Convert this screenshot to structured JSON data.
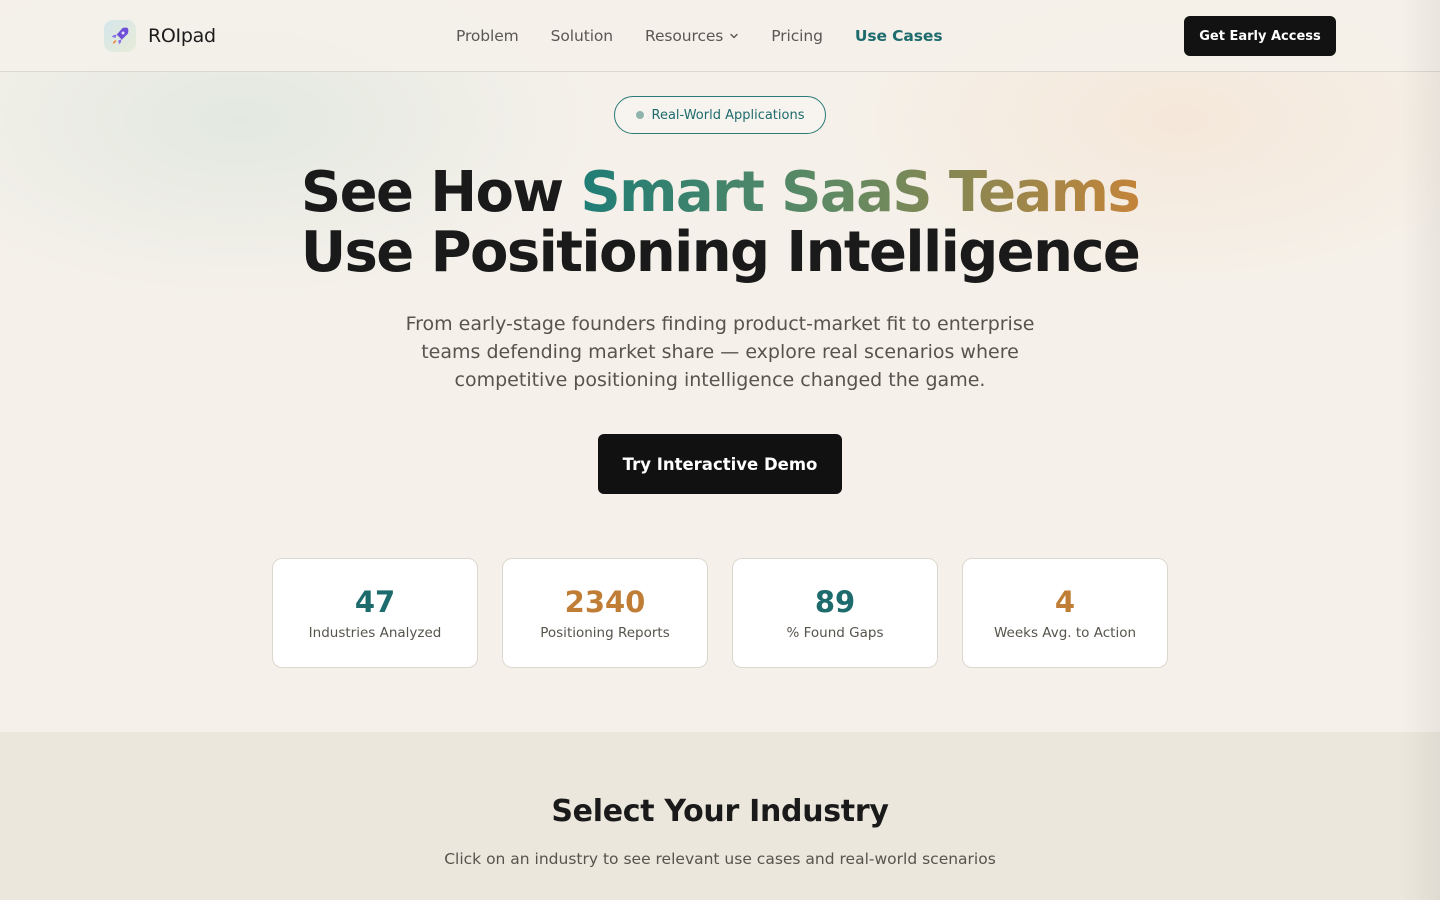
{
  "header": {
    "brand": "ROIpad",
    "logo_icon": "rocket-icon",
    "nav": [
      {
        "label": "Problem"
      },
      {
        "label": "Solution"
      },
      {
        "label": "Resources"
      },
      {
        "label": "Pricing"
      },
      {
        "label": "Use Cases"
      }
    ],
    "cta_label": "Get Early Access"
  },
  "hero": {
    "badge": "Real-World Applications",
    "title_part1": "See How ",
    "title_highlight": "Smart SaaS Teams",
    "title_line2": "Use Positioning Intelligence",
    "subtitle": "From early-stage founders finding product-market fit to enterprise teams defending market share — explore real scenarios where competitive positioning intelligence changed the game.",
    "demo_button": "Try Interactive Demo"
  },
  "stats": [
    {
      "value": "47",
      "label": "Industries Analyzed",
      "color": "#1d6b6c"
    },
    {
      "value": "2340",
      "label": "Positioning Reports",
      "color": "#c07d36"
    },
    {
      "value": "89",
      "label": "% Found Gaps",
      "color": "#1d6b6c"
    },
    {
      "value": "4",
      "label": "Weeks Avg. to Action",
      "color": "#c07d36"
    }
  ],
  "industry": {
    "title": "Select Your Industry",
    "subtitle": "Click on an industry to see relevant use cases and real-world scenarios"
  },
  "colors": {
    "accent_teal": "#1d6b6c",
    "accent_amber": "#c07d36",
    "background": "#f5f1ea",
    "button_dark": "#111111"
  }
}
